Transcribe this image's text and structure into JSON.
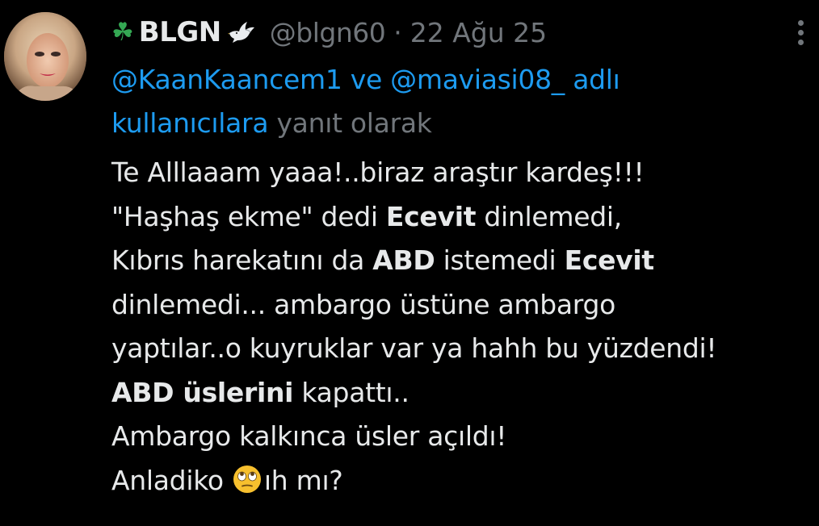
{
  "author": {
    "display_name": "BLGN",
    "handle": "@blgn60",
    "separator": "·",
    "date": "22 Ağu 25",
    "prefix_icon": "four-leaf-clover-icon",
    "suffix_icon": "dove-icon"
  },
  "reply_to": {
    "mention_1": "@KaanKaancem1",
    "connector": " ve ",
    "mention_2": "@maviasi08_",
    "suffix_link": " adlı kullanıcılara",
    "suffix_text": " yanıt olarak"
  },
  "tweet": {
    "line1": "Te Alllaaam yaaa!..biraz araştır kardeş!!!",
    "line2_a": "\"Haşhaş ekme\" dedi ",
    "line2_b": "Ecevit",
    "line2_c": " dinlemedi,",
    "line3_a": "Kıbrıs harekatını da ",
    "line3_b": "ABD",
    "line3_c": " istemedi ",
    "line3_d": "Ecevit",
    "line4": "dinlemedi... ambargo üstüne ambargo",
    "line5": "yaptılar..o kuyruklar var ya hahh bu yüzdendi!",
    "line6_a": "ABD üslerini",
    "line6_b": " kapattı..",
    "line7": "Ambargo kalkınca üsler açıldı!",
    "line8_a": "Anladiko ",
    "line8_emoji": "face-with-rolling-eyes-emoji",
    "line8_b": "ıh mı?"
  },
  "colors": {
    "background": "#000000",
    "text": "#e7e9ea",
    "secondary": "#71767b",
    "link": "#1d9bf0"
  }
}
